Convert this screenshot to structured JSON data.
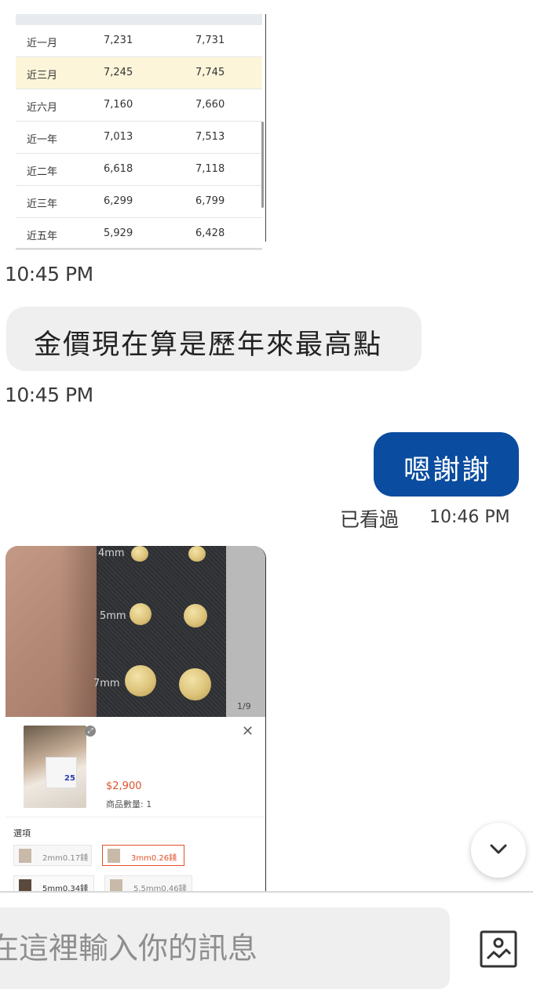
{
  "gold_table": {
    "rows": [
      {
        "period": "近一月",
        "a": "7,231",
        "b": "7,731",
        "highlight": false
      },
      {
        "period": "近三月",
        "a": "7,245",
        "b": "7,745",
        "highlight": true
      },
      {
        "period": "近六月",
        "a": "7,160",
        "b": "7,660",
        "highlight": false
      },
      {
        "period": "近一年",
        "a": "7,013",
        "b": "7,513",
        "highlight": false
      },
      {
        "period": "近二年",
        "a": "6,618",
        "b": "7,118",
        "highlight": false
      },
      {
        "period": "近三年",
        "a": "6,299",
        "b": "6,799",
        "highlight": false
      },
      {
        "period": "近五年",
        "a": "5,929",
        "b": "6,428",
        "highlight": false
      }
    ]
  },
  "messages": [
    {
      "timestamp": "10:45 PM"
    },
    {
      "text": "金價現在算是歷年來最高點",
      "timestamp": "10:45 PM"
    },
    {
      "text": "嗯謝謝",
      "seen": "已看過",
      "timestamp": "10:46 PM"
    }
  ],
  "product": {
    "labels": [
      "4mm",
      "5mm",
      "7mm"
    ],
    "page_indicator": "1/9",
    "thumb_badge": "25",
    "price": "$2,900",
    "quantity": "商品數量: 1",
    "options_title": "選項",
    "options": [
      "2mm0.17錢",
      "3mm0.26錢",
      "5mm0.34錢",
      "5.5mm0.46錢"
    ]
  },
  "composer": {
    "placeholder": "在這裡輸入你的訊息"
  },
  "colors": {
    "outgoing_bubble": "#0a4c9f",
    "incoming_bubble": "#efefef",
    "price": "#e0512a"
  },
  "icons": [
    "chevron-down-icon",
    "image-upload-icon",
    "close-icon",
    "zoom-icon"
  ]
}
